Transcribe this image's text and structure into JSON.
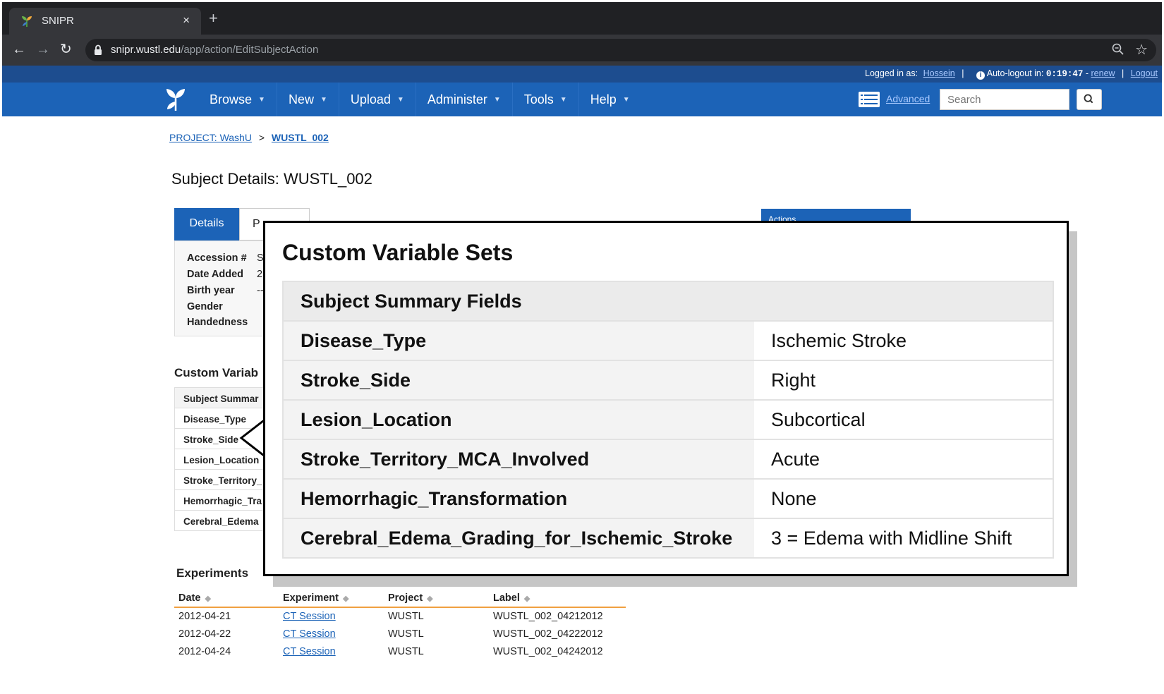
{
  "browser": {
    "tab_title": "SNIPR",
    "tab_close": "×",
    "new_tab": "+",
    "url_host": "snipr.wustl.edu",
    "url_path": "/app/action/EditSubjectAction",
    "back": "←",
    "forward": "→",
    "reload": "↻",
    "bookmark": "☆"
  },
  "topstrip": {
    "logged_in_label": "Logged in as:",
    "user": "Hossein",
    "autologout_label": "Auto-logout in:",
    "timer": "0:19:47",
    "dash": "-",
    "renew": "renew",
    "logout": "Logout"
  },
  "navbar": {
    "menu": [
      "Browse",
      "New",
      "Upload",
      "Administer",
      "Tools",
      "Help"
    ],
    "advanced": "Advanced",
    "search_placeholder": "Search"
  },
  "breadcrumb": {
    "project": "PROJECT: WashU",
    "separator": ">",
    "subject": "WUSTL_002"
  },
  "page_title": "Subject Details: WUSTL_002",
  "tabs": {
    "details": "Details",
    "projects_partial": "P"
  },
  "details": {
    "rows": [
      {
        "label": "Accession #",
        "value": "S"
      },
      {
        "label": "Date Added",
        "value": "2"
      },
      {
        "label": "Birth year",
        "value": "--"
      },
      {
        "label": "Gender",
        "value": ""
      },
      {
        "label": "Handedness",
        "value": ""
      }
    ]
  },
  "actions_partial": "Actions",
  "custom_variables_label": "Custom Variab",
  "custom_variables_rows": [
    "Subject Summar",
    "Disease_Type",
    "Stroke_Side",
    "Lesion_Location",
    "Stroke_Territory_",
    "Hemorrhagic_Tra",
    "Cerebral_Edema"
  ],
  "popup": {
    "title": "Custom Variable Sets",
    "section": "Subject Summary Fields",
    "fields": [
      {
        "name": "Disease_Type",
        "value": "Ischemic Stroke"
      },
      {
        "name": "Stroke_Side",
        "value": "Right"
      },
      {
        "name": "Lesion_Location",
        "value": "Subcortical"
      },
      {
        "name": "Stroke_Territory_MCA_Involved",
        "value": "Acute"
      },
      {
        "name": "Hemorrhagic_Transformation",
        "value": "None"
      },
      {
        "name": "Cerebral_Edema_Grading_for_Ischemic_Stroke",
        "value": "3 = Edema with Midline Shift"
      }
    ]
  },
  "experiments": {
    "label": "Experiments",
    "columns": [
      "Date",
      "Experiment",
      "Project",
      "Label"
    ],
    "rows": [
      {
        "date": "2012-04-21",
        "experiment": "CT Session",
        "project": "WUSTL",
        "label": "WUSTL_002_04212012"
      },
      {
        "date": "2012-04-22",
        "experiment": "CT Session",
        "project": "WUSTL",
        "label": "WUSTL_002_04222012"
      },
      {
        "date": "2012-04-24",
        "experiment": "CT Session",
        "project": "WUSTL",
        "label": "WUSTL_002_04242012"
      }
    ]
  },
  "icons": {
    "favicon": "snipr-logo-icon",
    "lock": "lock-icon",
    "zoom": "zoom-icon",
    "advanced": "list-icon",
    "search": "search-icon",
    "info": "info-icon",
    "sort": "sort-icon"
  },
  "colors": {
    "navbar": "#1c63b7",
    "topstrip": "#1d4d8f",
    "link": "#1c63b7",
    "table_rule": "#f0a040"
  }
}
